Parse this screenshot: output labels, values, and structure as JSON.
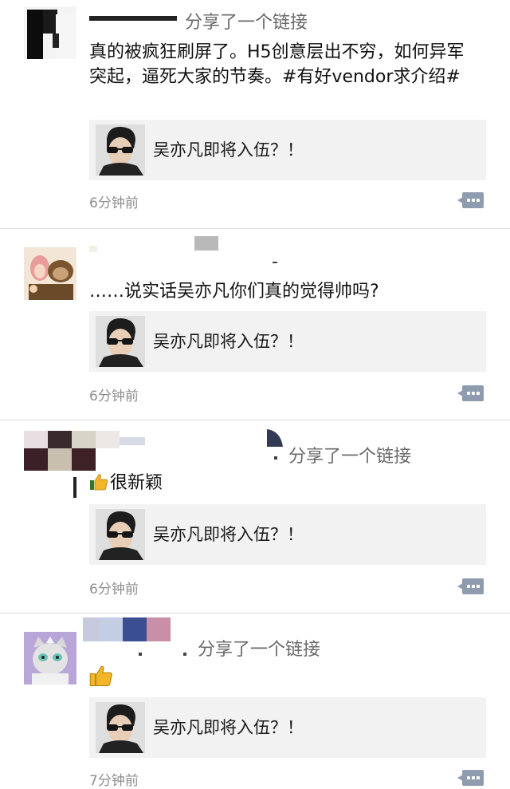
{
  "posts": [
    {
      "share_text": "分享了一个链接",
      "content": "真的被疯狂刷屏了。H5创意层出不穷，如何异军突起，逼死大家的节奏。#有好vendor求介绍#",
      "link_title": "吴亦凡即将入伍？！",
      "time": "6分钟前"
    },
    {
      "share_text": "",
      "content": "……说实话吴亦凡你们真的觉得帅吗?",
      "link_title": "吴亦凡即将入伍？！",
      "time": "6分钟前"
    },
    {
      "share_text": "分享了一个链接",
      "content": "很新颖",
      "link_title": "吴亦凡即将入伍？！",
      "time": "6分钟前"
    },
    {
      "share_text": "分享了一个链接",
      "content": "",
      "link_title": "吴亦凡即将入伍？！",
      "time": "7分钟前"
    }
  ],
  "icons": {
    "comment": "comment-icon",
    "thumbs_up": "thumbs-up-icon"
  },
  "colors": {
    "card_bg": "#f2f2f2",
    "time_text": "#8e8e8e",
    "comment_button": "#8f9cb0"
  }
}
